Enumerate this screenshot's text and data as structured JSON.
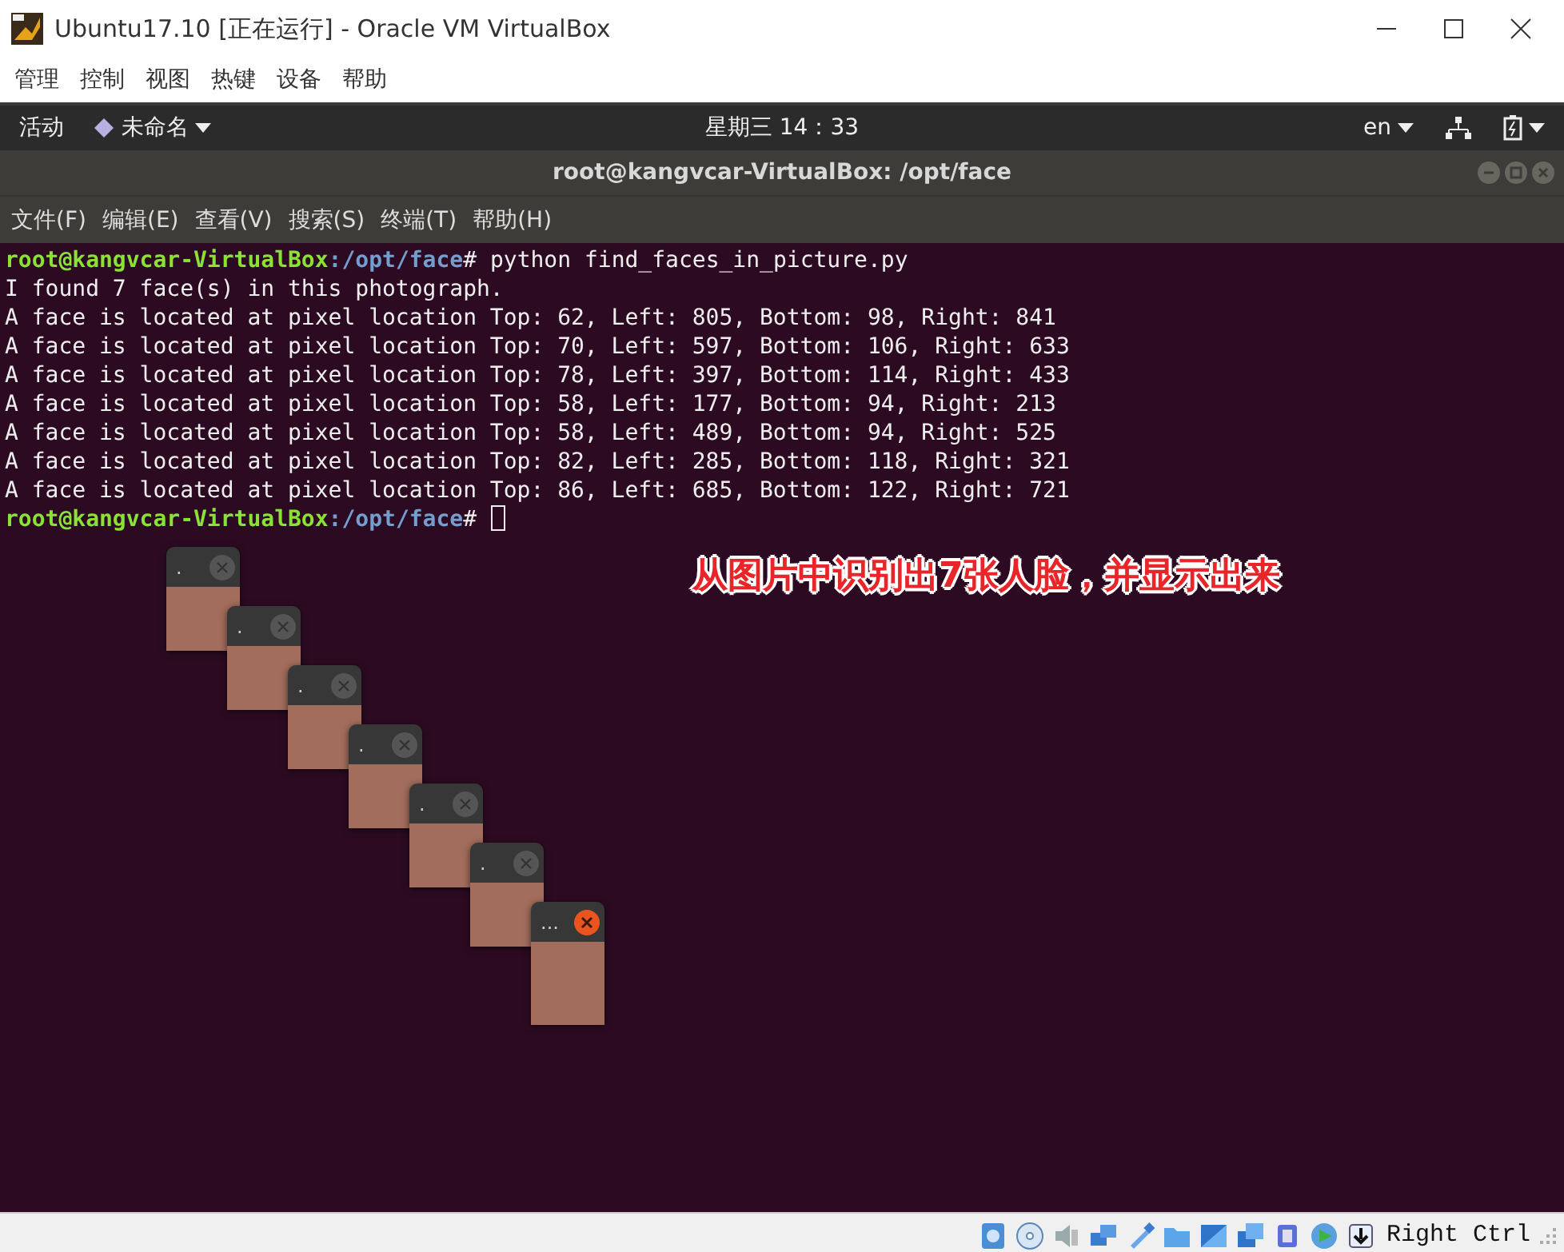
{
  "window": {
    "title": "Ubuntu17.10 [正在运行] - Oracle VM VirtualBox",
    "menu": [
      "管理",
      "控制",
      "视图",
      "热键",
      "设备",
      "帮助"
    ]
  },
  "top_bar": {
    "activities": "活动",
    "app_name": "未命名",
    "clock": "星期三 14：33",
    "language": "en"
  },
  "terminal": {
    "title": "root@kangvcar-VirtualBox: /opt/face",
    "menu": [
      "文件(F)",
      "编辑(E)",
      "查看(V)",
      "搜索(S)",
      "终端(T)",
      "帮助(H)"
    ],
    "lines": [
      {
        "kind": "prompt",
        "user_host": "root@kangvcar-VirtualBox",
        "path": ":/opt/face",
        "symbol": "#",
        "command": " python find_faces_in_picture.py"
      },
      {
        "kind": "output",
        "text": "I found 7 face(s) in this photograph."
      },
      {
        "kind": "output",
        "text": "A face is located at pixel location Top: 62, Left: 805, Bottom: 98, Right: 841"
      },
      {
        "kind": "output",
        "text": "A face is located at pixel location Top: 70, Left: 597, Bottom: 106, Right: 633"
      },
      {
        "kind": "output",
        "text": "A face is located at pixel location Top: 78, Left: 397, Bottom: 114, Right: 433"
      },
      {
        "kind": "output",
        "text": "A face is located at pixel location Top: 58, Left: 177, Bottom: 94, Right: 213"
      },
      {
        "kind": "output",
        "text": "A face is located at pixel location Top: 58, Left: 489, Bottom: 94, Right: 525"
      },
      {
        "kind": "output",
        "text": "A face is located at pixel location Top: 82, Left: 285, Bottom: 118, Right: 321"
      },
      {
        "kind": "output",
        "text": "A face is located at pixel location Top: 86, Left: 685, Bottom: 122, Right: 721"
      },
      {
        "kind": "prompt",
        "user_host": "root@kangvcar-VirtualBox",
        "path": ":/opt/face",
        "symbol": "#",
        "cursor": true
      }
    ]
  },
  "face_windows": [
    {
      "title": ".",
      "active": false
    },
    {
      "title": ".",
      "active": false
    },
    {
      "title": ".",
      "active": false
    },
    {
      "title": ".",
      "active": false
    },
    {
      "title": ".",
      "active": false
    },
    {
      "title": ".",
      "active": false
    },
    {
      "title": "...",
      "active": true
    }
  ],
  "caption": "从图片中识别出7张人脸，并显示出来",
  "status_bar": {
    "host_key": "Right Ctrl"
  }
}
